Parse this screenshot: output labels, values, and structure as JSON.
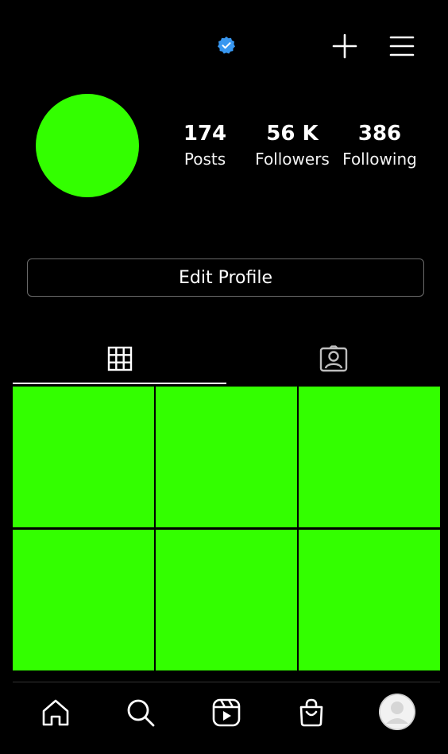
{
  "header": {
    "verified_icon": "verified-badge-icon",
    "add_icon": "plus-icon",
    "menu_icon": "hamburger-menu-icon",
    "verified_color": "#3897f0"
  },
  "profile": {
    "avatar_color": "#33ff00",
    "stats": {
      "posts": {
        "value": "174",
        "label": "Posts"
      },
      "followers": {
        "value": "56 K",
        "label": "Followers"
      },
      "following": {
        "value": "386",
        "label": "Following"
      }
    },
    "edit_profile_label": "Edit Profile"
  },
  "tabs": [
    {
      "icon": "grid-icon",
      "active": true
    },
    {
      "icon": "tagged-person-icon",
      "active": false
    }
  ],
  "posts_grid": {
    "tile_color": "#33ff00",
    "tiles": 6
  },
  "bottom_nav": [
    {
      "icon": "home-icon"
    },
    {
      "icon": "search-icon"
    },
    {
      "icon": "reels-icon"
    },
    {
      "icon": "shop-bag-icon"
    },
    {
      "icon": "profile-avatar-icon"
    }
  ]
}
